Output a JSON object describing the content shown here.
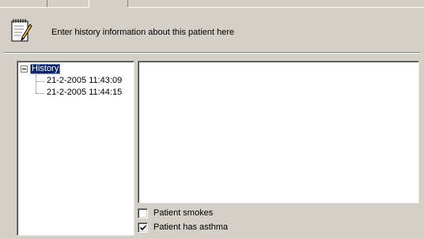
{
  "header": {
    "text": "Enter history information about this patient here",
    "icon": "notepad-icon"
  },
  "tree": {
    "root_label": "History",
    "entries": [
      "21-2-2005 11:43:09",
      "21-2-2005 11:44:15"
    ]
  },
  "detail": {
    "text": ""
  },
  "options": {
    "smokes_label": "Patient smokes",
    "smokes_checked": false,
    "asthma_label": "Patient has asthma",
    "asthma_checked": true
  }
}
